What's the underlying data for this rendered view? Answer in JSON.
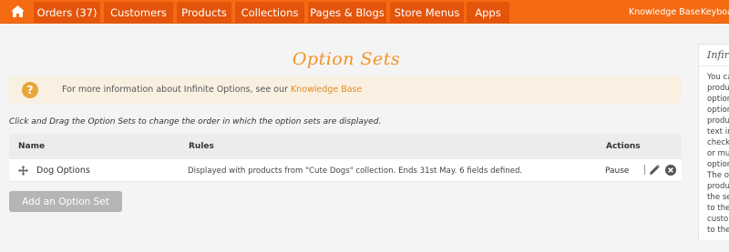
{
  "nav": {
    "tabs": [
      "Orders (37)",
      "Customers",
      "Products",
      "Collections",
      "Pages & Blogs",
      "Store Menus",
      "Apps"
    ],
    "right_links": [
      "Knowledge Base",
      "Keyboa"
    ]
  },
  "page": {
    "title": "Option Sets",
    "info_prefix": "For more information about Infinite Options, see our ",
    "info_link": "Knowledge Base",
    "instructions": "Click and Drag the Option Sets to change the order in which the option sets are displayed."
  },
  "table": {
    "headers": {
      "name": "Name",
      "rules": "Rules",
      "actions": "Actions"
    },
    "rows": [
      {
        "name": "Dog Options",
        "rules": "Displayed with products from \"Cute Dogs\" collection. Ends 31st May. 6 fields defined.",
        "pause": "Pause"
      }
    ]
  },
  "add_button": "Add an Option Set",
  "side_panel": {
    "title": "Infir",
    "lines": [
      "You ca",
      "produ",
      "option",
      "option",
      "produ",
      "text in",
      "check",
      "or mul",
      "option",
      "",
      "The op",
      "produ",
      "the se",
      "to the",
      "custo",
      "to the"
    ]
  },
  "colors": {
    "nav_bg": "#f46b13",
    "nav_tab": "#e4540a",
    "title_accent": "#f39426",
    "link": "#e48a1c"
  },
  "icons": [
    "home-icon",
    "info-icon",
    "drag-handle-icon",
    "edit-pencil-icon",
    "delete-x-icon"
  ]
}
